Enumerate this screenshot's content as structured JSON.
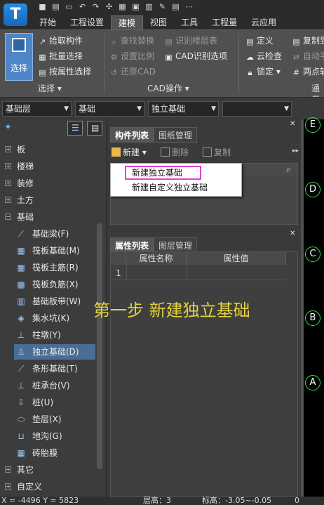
{
  "app": {
    "logo": "T"
  },
  "tabs": [
    "开始",
    "工程设置",
    "建模",
    "视图",
    "工具",
    "工程量",
    "云应用"
  ],
  "ribbon": {
    "select": "选择",
    "select_group": [
      "拾取构件",
      "批量选择",
      "按属性选择"
    ],
    "select_group_label": "选择",
    "cad_group": [
      "查找替换",
      "设置比例",
      "还原CAD",
      "识别楼层表",
      "CAD识别选项"
    ],
    "cad_group_label": "CAD操作",
    "common_group": [
      "定义",
      "云检查",
      "锁定",
      "复制到",
      "自动平",
      "两点辅"
    ],
    "common_group_label": "通用"
  },
  "combos": {
    "floor": "基础层",
    "category": "基础",
    "type": "独立基础",
    "extra": ""
  },
  "tree": {
    "top": [
      "板",
      "楼梯",
      "装修",
      "土方",
      "基础"
    ],
    "children": [
      "基础梁(F)",
      "筏板基础(M)",
      "筏板主筋(R)",
      "筏板负筋(X)",
      "基础板带(W)",
      "集水坑(K)",
      "柱墩(Y)",
      "独立基础(D)",
      "条形基础(T)",
      "桩承台(V)",
      "桩(U)",
      "垫层(X)",
      "地沟(G)",
      "砖胎膜"
    ],
    "bottom": [
      "其它",
      "自定义"
    ]
  },
  "component_panel": {
    "tabs": [
      "构件列表",
      "图纸管理"
    ],
    "new_btn": "新建",
    "delete_btn": "删除",
    "copy_btn": "复制",
    "menu": [
      "新建独立基础",
      "新建自定义独立基础"
    ]
  },
  "property_panel": {
    "tabs": [
      "属性列表",
      "图层管理"
    ],
    "columns": [
      "属性名称",
      "属性值"
    ],
    "rows": [
      "1"
    ]
  },
  "caption": "第一步 新建独立基础",
  "axes": [
    "E",
    "D",
    "C",
    "B",
    "A"
  ],
  "status": {
    "coords": "X = -4496 Y = 5823",
    "floor_height": "层高：3",
    "elevation": "标高：-3.05~-0.05",
    "value": "0"
  },
  "colors": {
    "accent": "#4e86c8",
    "highlight": "#e13ed6",
    "caption": "#e6d23c",
    "axis": "#36e03a"
  }
}
